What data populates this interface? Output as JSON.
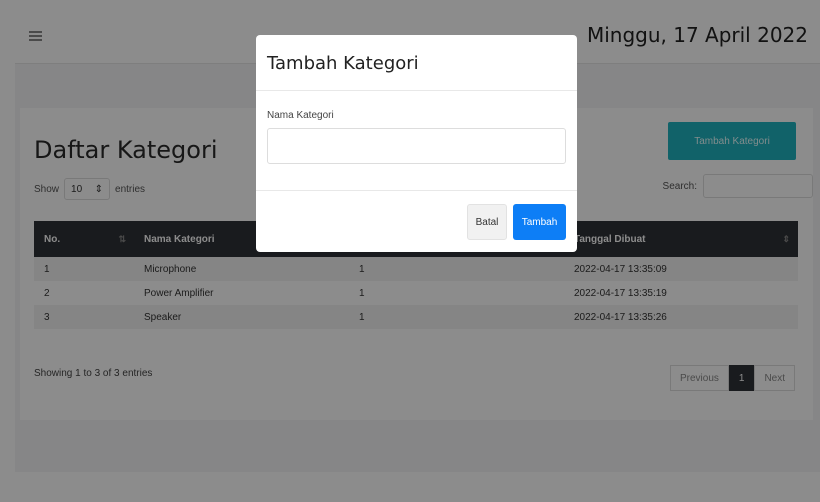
{
  "header": {
    "date": "Minggu, 17 April 2022"
  },
  "page": {
    "title": "Daftar Kategori",
    "add_button": "Tambah Kategori",
    "show_label": "Show",
    "entries_value": "10",
    "entries_label": "entries",
    "search_label": "Search:"
  },
  "table": {
    "columns": [
      "No.",
      "Nama Kategori",
      "",
      "Tanggal Dibuat"
    ],
    "rows": [
      {
        "no": "1",
        "name": "Microphone",
        "count": "1",
        "date": "2022-04-17 13:35:09"
      },
      {
        "no": "2",
        "name": "Power Amplifier",
        "count": "1",
        "date": "2022-04-17 13:35:19"
      },
      {
        "no": "3",
        "name": "Speaker",
        "count": "1",
        "date": "2022-04-17 13:35:26"
      }
    ],
    "info": "Showing 1 to 3 of 3 entries"
  },
  "pagination": {
    "previous": "Previous",
    "current": "1",
    "next": "Next"
  },
  "modal": {
    "title": "Tambah Kategori",
    "field_label": "Nama Kategori",
    "field_value": "",
    "cancel": "Batal",
    "submit": "Tambah"
  },
  "colors": {
    "accent": "#20b2c0",
    "primary": "#0d7ef6",
    "table_header": "#2f3237"
  }
}
